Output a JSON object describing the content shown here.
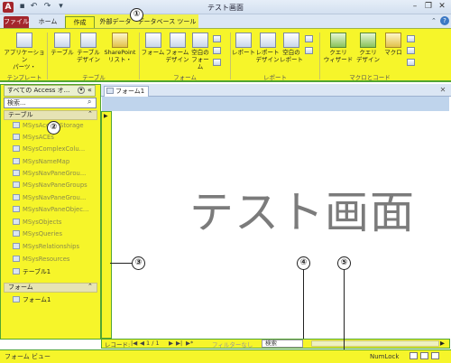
{
  "window": {
    "title": "テスト画面",
    "app_icon": "A",
    "quick_access": [
      "save-icon",
      "undo-icon",
      "redo-icon",
      "customize-icon"
    ],
    "controls": [
      "minimize-icon",
      "restore-icon",
      "close-icon"
    ]
  },
  "tabs": {
    "file": "ファイル",
    "home": "ホーム",
    "create": "作成",
    "external": "外部データ",
    "dbtools": "データベース ツール"
  },
  "ribbon": {
    "groups": {
      "template": "テンプレート",
      "table": "テーブル",
      "form": "フォーム",
      "report": "レポート",
      "macro": "マクロとコード"
    },
    "buttons": {
      "app_parts": "アプリケーション\nパーツ・",
      "table": "テーブル",
      "table_design": "テーブル\nデザイン",
      "sharepoint": "SharePoint\nリスト・",
      "form": "フォーム",
      "form_design": "フォーム\nデザイン",
      "blank_form": "空白の\nフォーム",
      "report": "レポート",
      "report_design": "レポート\nデザイン",
      "blank_report": "空白の\nレポート",
      "query_wizard": "クエリ\nウィザード",
      "query_design": "クエリ\nデザイン",
      "macro": "マクロ"
    }
  },
  "nav": {
    "header": "すべての Access オ...",
    "search_placeholder": "検索...",
    "section_tables": "テーブル",
    "tables": [
      "MSysAccessStorage",
      "MSysACEs",
      "MSysComplexColu...",
      "MSysNameMap",
      "MSysNavPaneGrou...",
      "MSysNavPaneGroups",
      "MSysNavPaneGrou...",
      "MSysNavPaneObjec...",
      "MSysObjects",
      "MSysQueries",
      "MSysRelationships",
      "MSysResources",
      "テーブル1"
    ],
    "section_forms": "フォーム",
    "forms": [
      "フォーム1"
    ]
  },
  "document": {
    "tab_label": "フォーム1",
    "big_text": "テスト画面"
  },
  "record_nav": {
    "label": "レコード:",
    "position": "1 / 1",
    "filter": "フィルターなし",
    "search": "検索"
  },
  "status": {
    "view": "フォーム ビュー",
    "numlock": "NumLock"
  },
  "callouts": [
    "①",
    "②",
    "③",
    "④",
    "⑤"
  ],
  "colors": {
    "highlight": "#f6f52a",
    "highlight_border": "#52a532",
    "file_tab": "#a4262c"
  }
}
